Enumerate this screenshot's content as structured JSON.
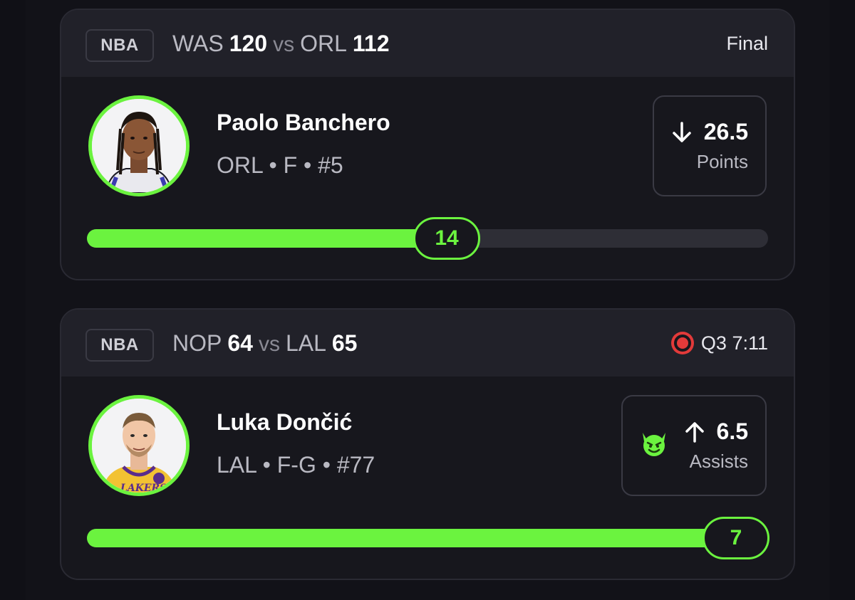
{
  "colors": {
    "accent": "#6bf33f",
    "live": "#e23a3a"
  },
  "cards": [
    {
      "league": "NBA",
      "away_team": "WAS",
      "away_score": "120",
      "vs": "vs",
      "home_team": "ORL",
      "home_score": "112",
      "status": "Final",
      "status_live": false,
      "player_name": "Paolo Banchero",
      "player_meta": "ORL • F • #5",
      "direction": "down-arrow-icon",
      "line_value": "26.5",
      "line_stat": "Points",
      "current": "14",
      "progress": 0.53
    },
    {
      "league": "NBA",
      "away_team": "NOP",
      "away_score": "64",
      "vs": "vs",
      "home_team": "LAL",
      "home_score": "65",
      "status": "Q3 7:11",
      "status_live": true,
      "player_name": "Luka Dončić",
      "player_meta": "LAL • F-G • #77",
      "badge_icon": "demon-emoji-icon",
      "direction": "up-arrow-icon",
      "line_value": "6.5",
      "line_stat": "Assists",
      "current": "7",
      "progress": 1.0
    }
  ]
}
